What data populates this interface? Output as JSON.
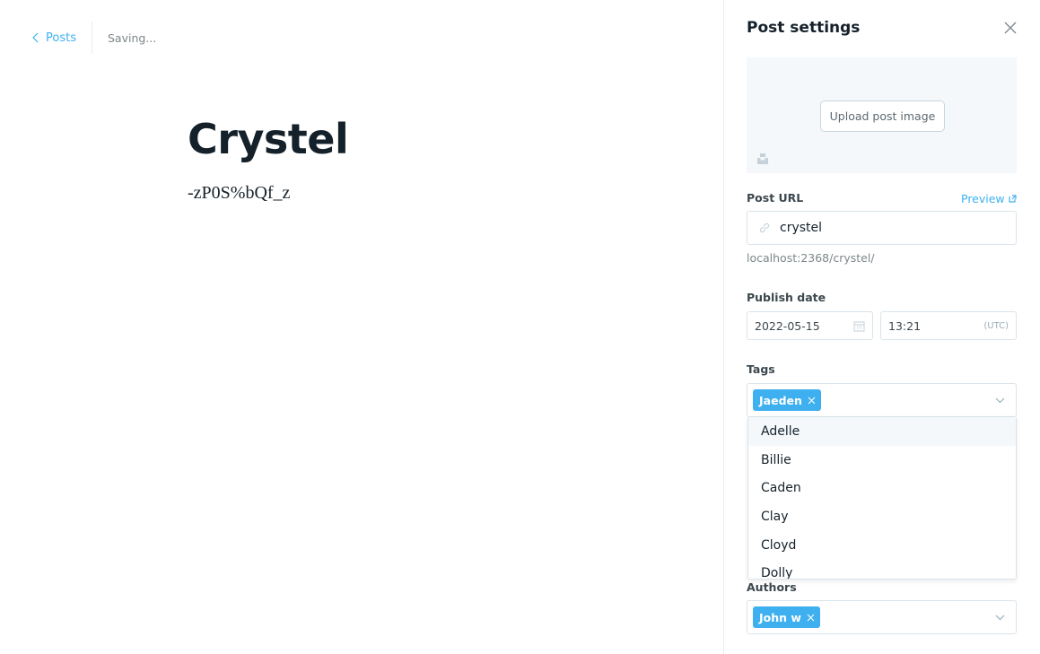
{
  "nav": {
    "back_label": "Posts",
    "status": "Saving..."
  },
  "post": {
    "title": "Crystel",
    "body": "-zP0S%bQf_z"
  },
  "settings": {
    "title": "Post settings",
    "upload_label": "Upload post image",
    "url_label": "Post URL",
    "preview_label": "Preview",
    "url_value": "crystel",
    "url_hint": "localhost:2368/crystel/",
    "publish_label": "Publish date",
    "date_value": "2022-05-15",
    "time_value": "13:21",
    "timezone": "(UTC)",
    "tags_label": "Tags",
    "tags": [
      "Jaeden"
    ],
    "tag_options": [
      "Adelle",
      "Billie",
      "Caden",
      "Clay",
      "Cloyd",
      "Dolly"
    ],
    "authors_label": "Authors",
    "authors": [
      "John w"
    ]
  },
  "colors": {
    "accent": "#3eb0ef",
    "text": "#15212a",
    "muted": "#7d878a",
    "border": "#dae4ea"
  }
}
